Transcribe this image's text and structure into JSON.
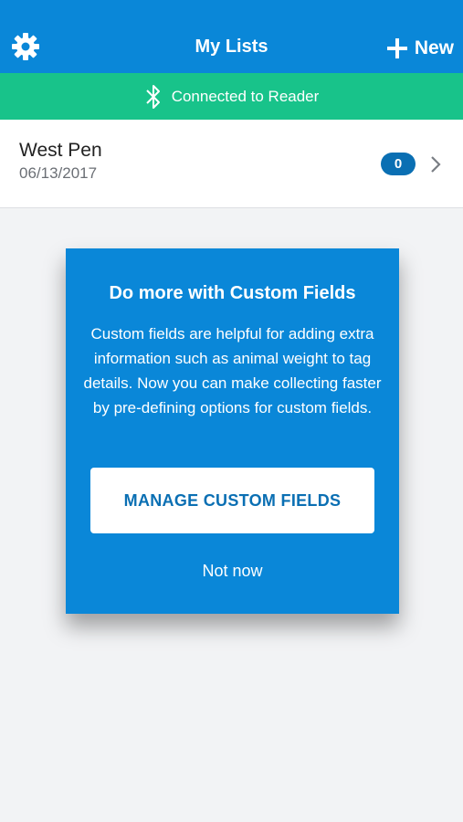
{
  "header": {
    "title": "My Lists",
    "new_label": "New",
    "settings_icon": "gear-icon",
    "add_icon": "plus-icon"
  },
  "banner": {
    "text": "Connected to Reader",
    "icon": "bluetooth-icon",
    "color": "#18c38a"
  },
  "lists": [
    {
      "name": "West Pen",
      "date": "06/13/2017",
      "count": "0"
    }
  ],
  "modal": {
    "title": "Do more with Custom Fields",
    "body": "Custom fields are helpful for adding extra information such as animal weight to tag details. Now you can make collecting faster by pre-defining options for custom fields.",
    "primary_button": "MANAGE CUSTOM FIELDS",
    "secondary_button": "Not now"
  },
  "colors": {
    "primary": "#0a87d8",
    "badge": "#0a6fb3",
    "background": "#f2f3f5"
  }
}
